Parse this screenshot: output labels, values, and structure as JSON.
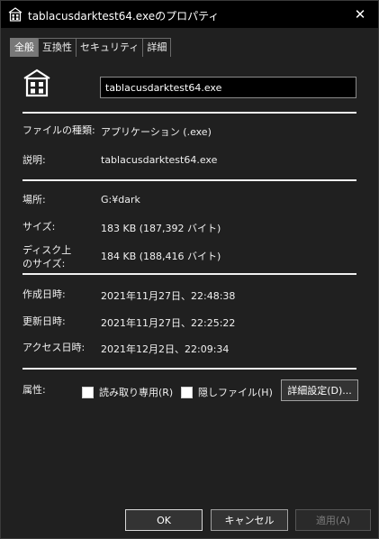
{
  "window": {
    "title": "tablacusdarktest64.exeのプロパティ",
    "close_glyph": "✕"
  },
  "tabs": [
    {
      "label": "全般",
      "active": true
    },
    {
      "label": "互換性",
      "active": false
    },
    {
      "label": "セキュリティ",
      "active": false
    },
    {
      "label": "詳細",
      "active": false
    }
  ],
  "general": {
    "file_name": "tablacusdarktest64.exe",
    "rows": {
      "file_type": {
        "label": "ファイルの種類:",
        "value": "アプリケーション (.exe)"
      },
      "description": {
        "label": "説明:",
        "value": "tablacusdarktest64.exe"
      },
      "location": {
        "label": "場所:",
        "value": "G:¥dark"
      },
      "size": {
        "label": "サイズ:",
        "value": "183 KB (187,392 バイト)"
      },
      "size_on_disk": {
        "label_line1": "ディスク上",
        "label_line2": "のサイズ:",
        "value": "184 KB (188,416 バイト)"
      },
      "created": {
        "label": "作成日時:",
        "value": "2021年11月27日、22:48:38"
      },
      "modified": {
        "label": "更新日時:",
        "value": "2021年11月27日、22:25:22"
      },
      "accessed": {
        "label": "アクセス日時:",
        "value": "2021年12月2日、22:09:34"
      }
    },
    "attributes": {
      "label": "属性:",
      "readonly": {
        "label": "読み取り専用(R)",
        "checked": false
      },
      "hidden": {
        "label": "隠しファイル(H)",
        "checked": false
      },
      "advanced_button": "詳細設定(D)..."
    }
  },
  "footer": {
    "ok": "OK",
    "cancel": "キャンセル",
    "apply": "適用(A)"
  },
  "colors": {
    "background": "#202020",
    "titlebar": "#000000",
    "active_tab": "#777777",
    "text": "#f0f0f0"
  },
  "icons": {
    "title": "app-building-icon",
    "app": "app-building-icon",
    "close": "close-icon"
  }
}
